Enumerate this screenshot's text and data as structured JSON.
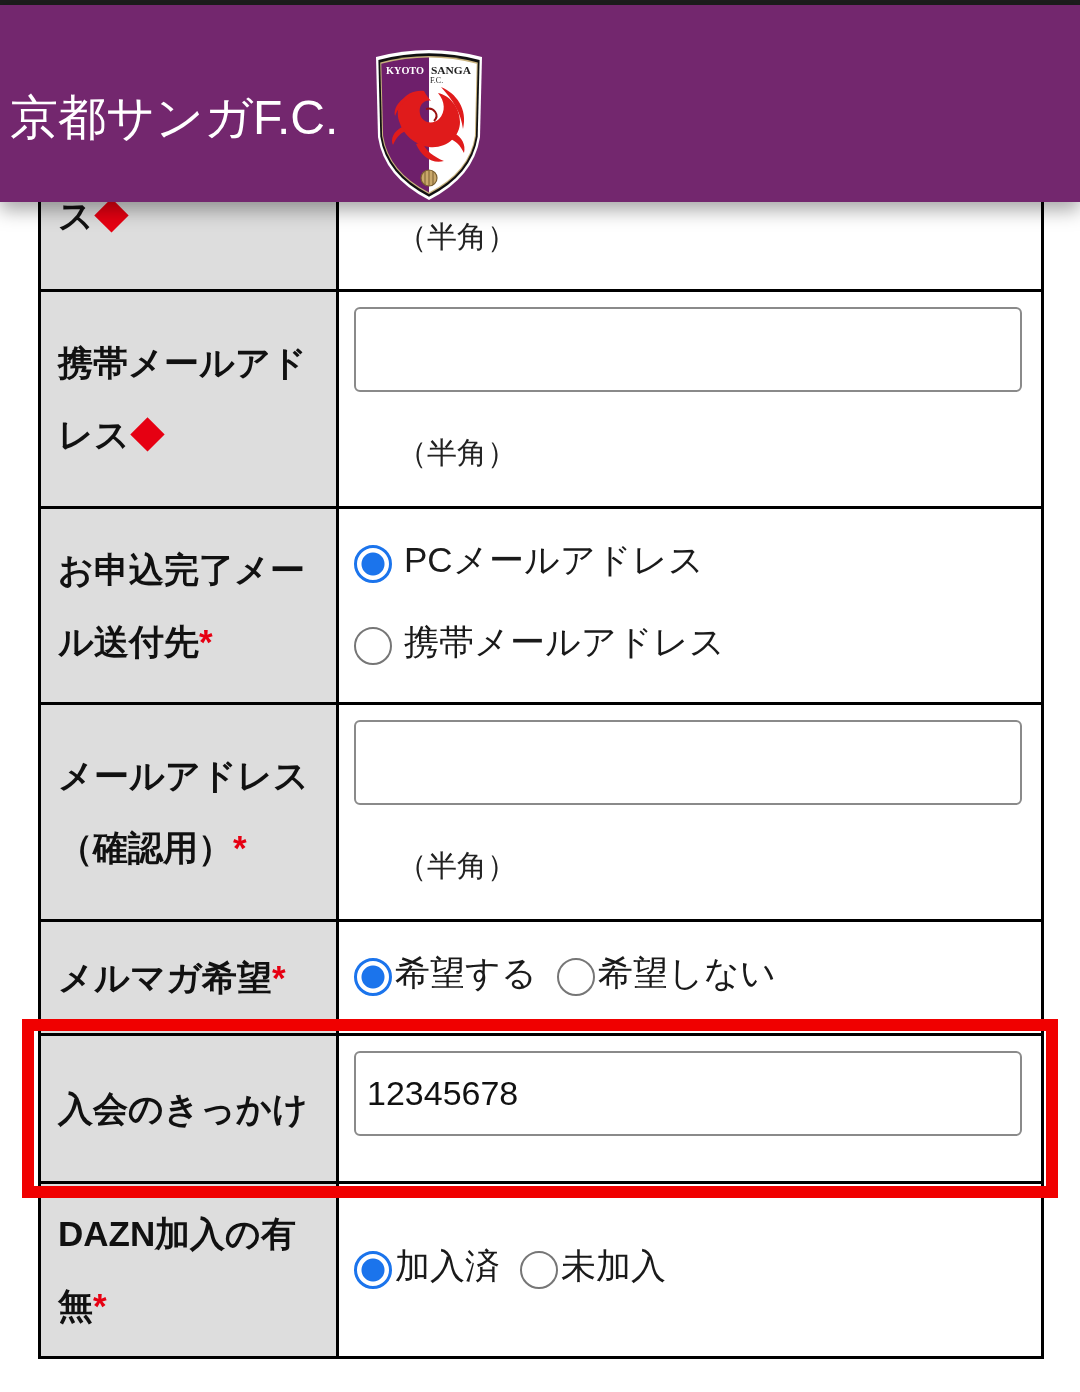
{
  "header": {
    "title": "京都サンガF.C.",
    "logo": {
      "left_text": "KYOTO",
      "right_text": "SANGA",
      "sub_text": "F.C."
    }
  },
  "rows": [
    {
      "kind": "note",
      "label": "ス",
      "mark": "◆",
      "note": "（半角）",
      "highlighted": false
    },
    {
      "kind": "text",
      "label": "携帯メールアドレス",
      "mark": "◆",
      "note": "（半角）",
      "highlighted": false
    },
    {
      "kind": "radiocolumn",
      "label": "お申込完了メール送付先",
      "mark": "*",
      "options": [
        {
          "label": "PCメールアドレス",
          "selected": true
        },
        {
          "label": "携帯メールアドレス",
          "selected": false
        }
      ],
      "highlighted": false
    },
    {
      "kind": "text",
      "label": "メールアドレス（確認用）",
      "mark": "*",
      "note": "（半角）",
      "highlighted": false
    },
    {
      "kind": "radioline",
      "label": "メルマガ希望",
      "mark": "*",
      "options": [
        {
          "label": "希望する",
          "selected": true
        },
        {
          "label": "希望しない",
          "selected": false
        }
      ],
      "highlighted": false
    },
    {
      "kind": "text",
      "label": "入会のきっかけ",
      "value": "12345678",
      "highlighted": true
    },
    {
      "kind": "radioline",
      "label": "DAZN加入の有無",
      "mark": "*",
      "options": [
        {
          "label": "加入済",
          "selected": true
        },
        {
          "label": "未加入",
          "selected": false
        }
      ],
      "highlighted": false
    }
  ]
}
